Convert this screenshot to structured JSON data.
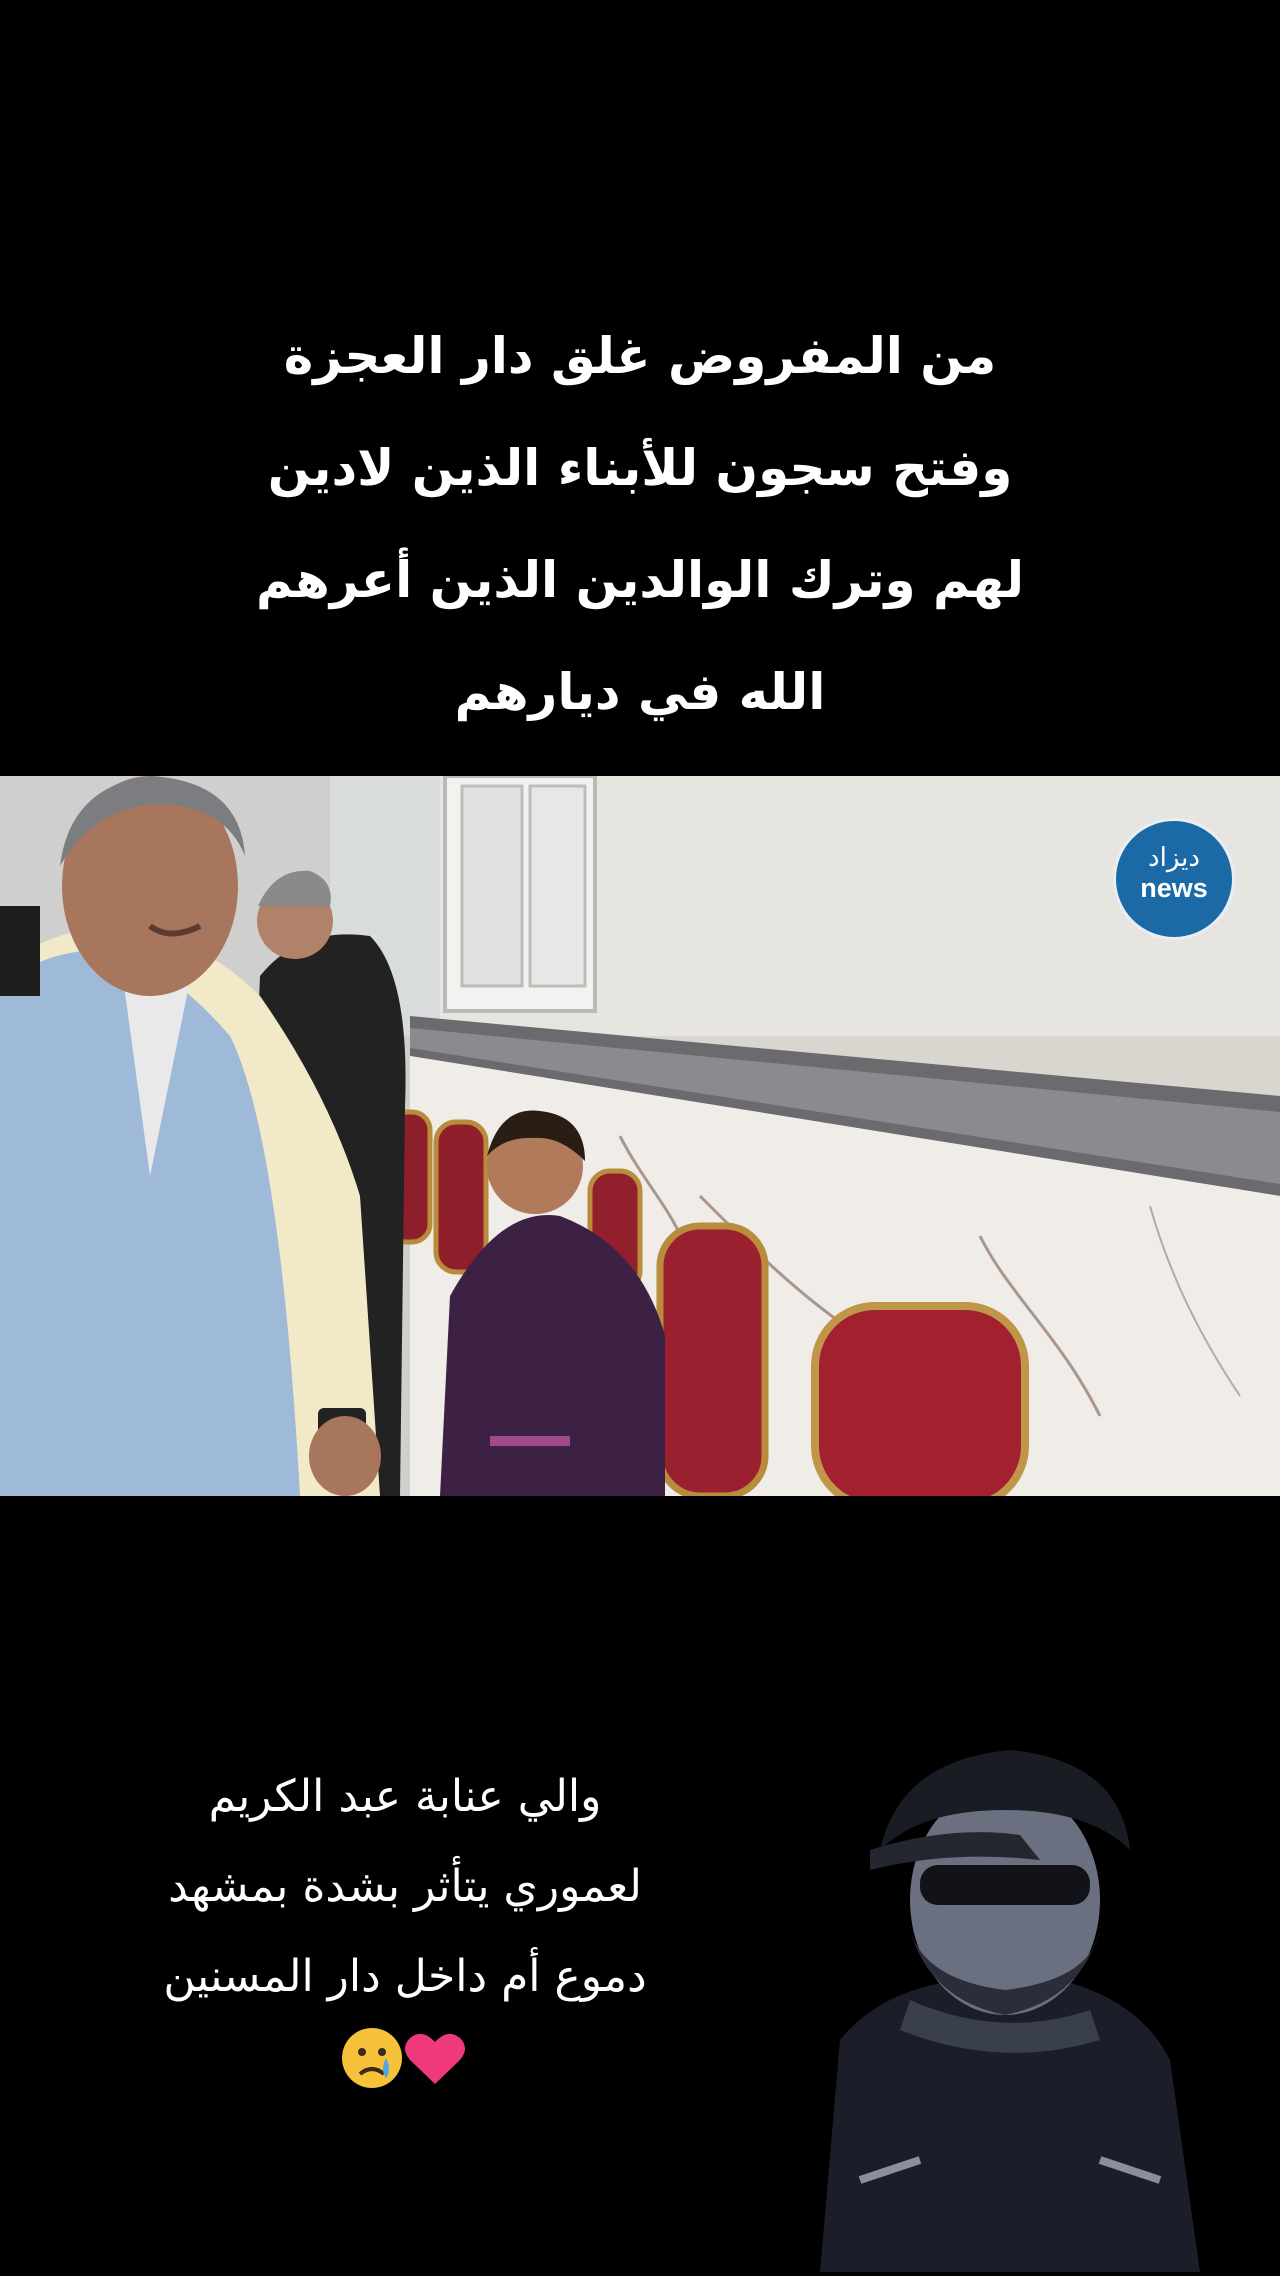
{
  "top_caption": {
    "lines": [
      "من المفروض غلق دار العجزة",
      "وفتح سجون للأبناء الذين لادين",
      "لهم وترك الوالدين الذين أعرهم",
      "الله في ديارهم"
    ]
  },
  "logo": {
    "arabic": "ديزاد",
    "latin": "news",
    "color": "#1b6aa5"
  },
  "bottom_caption": {
    "lines": [
      "والي عنابة عبد الكريم",
      "لعموري يتأثر بشدة بمشهد",
      "دموع أم داخل دار المسنين"
    ],
    "emojis": "😢💗"
  },
  "icons": {
    "crying_face": "crying-face-icon",
    "heart": "heart-icon"
  }
}
